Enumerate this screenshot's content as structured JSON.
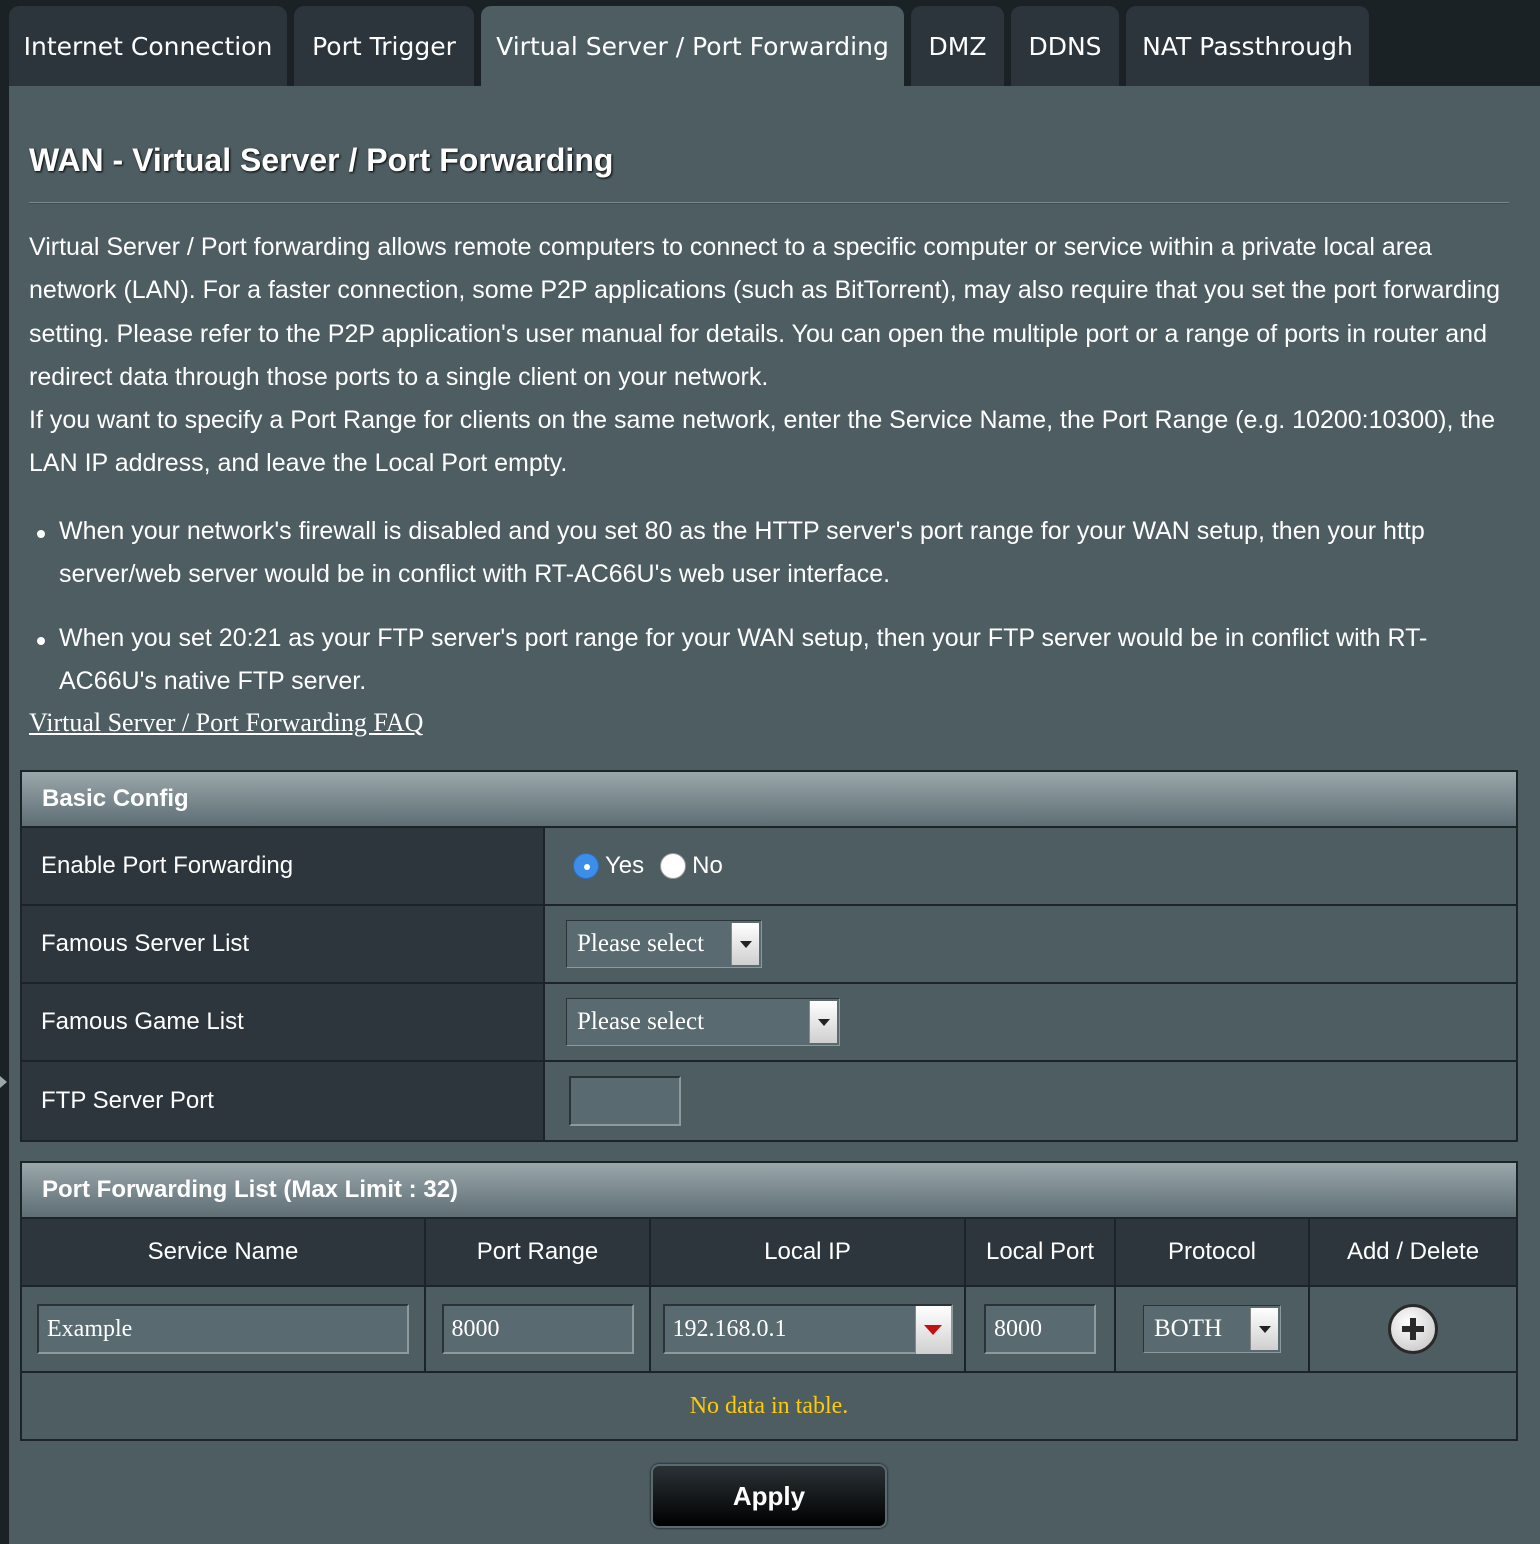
{
  "tabs": [
    {
      "label": "Internet Connection",
      "active": false
    },
    {
      "label": "Port Trigger",
      "active": false
    },
    {
      "label": "Virtual Server / Port Forwarding",
      "active": true
    },
    {
      "label": "DMZ",
      "active": false
    },
    {
      "label": "DDNS",
      "active": false
    },
    {
      "label": "NAT Passthrough",
      "active": false
    }
  ],
  "page": {
    "title": "WAN - Virtual Server / Port Forwarding",
    "description_1": "Virtual Server / Port forwarding allows remote computers to connect to a specific computer or service within a private local area network (LAN). For a faster connection, some P2P applications (such as BitTorrent), may also require that you set the port forwarding setting. Please refer to the P2P application's user manual for details. You can open the multiple port or a range of ports in router and redirect data through those ports to a single client on your network.",
    "description_2": "If you want to specify a Port Range for clients on the same network, enter the Service Name, the Port Range (e.g. 10200:10300), the LAN IP address, and leave the Local Port empty.",
    "notes": [
      "When your network's firewall is disabled and you set 80 as the HTTP server's port range for your WAN setup, then your http server/web server would be in conflict with RT-AC66U's web user interface.",
      "When you set 20:21 as your FTP server's port range for your WAN setup, then your FTP server would be in conflict with RT-AC66U's native FTP server."
    ],
    "faq_link": "Virtual Server / Port Forwarding FAQ"
  },
  "basic_config": {
    "header": "Basic Config",
    "enable_label": "Enable Port Forwarding",
    "yes_label": "Yes",
    "no_label": "No",
    "enabled": true,
    "famous_server_label": "Famous Server List",
    "famous_server_value": "Please select",
    "famous_game_label": "Famous Game List",
    "famous_game_value": "Please select",
    "ftp_port_label": "FTP Server Port",
    "ftp_port_value": ""
  },
  "port_list": {
    "header": "Port Forwarding List (Max Limit : 32)",
    "columns": [
      "Service Name",
      "Port Range",
      "Local IP",
      "Local Port",
      "Protocol",
      "Add / Delete"
    ],
    "entry": {
      "service_name": "Example",
      "port_range": "8000",
      "local_ip": "192.168.0.1",
      "local_port": "8000",
      "protocol": "BOTH"
    },
    "empty_message": "No data in table."
  },
  "apply_label": "Apply",
  "colors": {
    "panel": "#4d5d62",
    "tab_inactive": "#2b353b",
    "label_cell": "#2c363c",
    "empty_message": "#ffcc00",
    "radio_selected": "#3d8ee8",
    "dropdown_arrow_red": "#c41010"
  },
  "icons": [
    "plus-circle-icon",
    "chevron-down-icon"
  ]
}
